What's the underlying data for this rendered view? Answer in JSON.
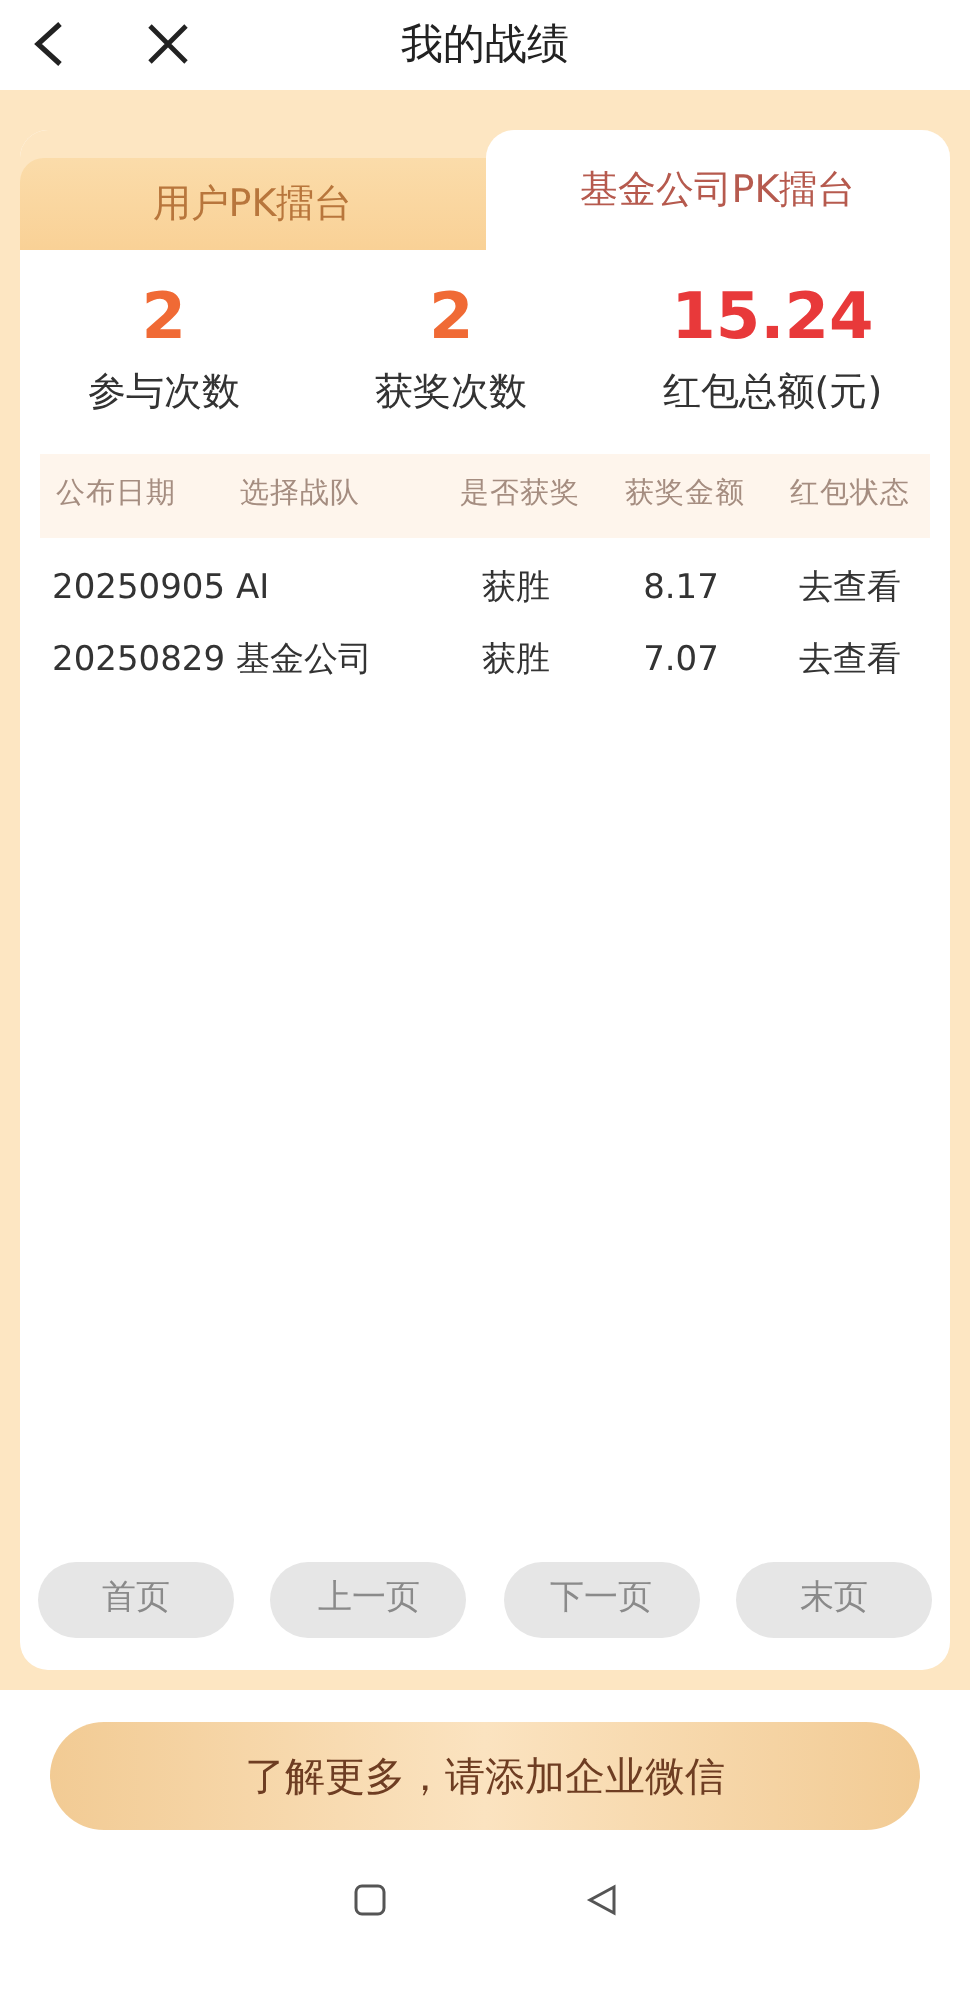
{
  "header": {
    "title": "我的战绩"
  },
  "tabs": [
    {
      "label": "用户PK擂台",
      "selected": false
    },
    {
      "label": "基金公司PK擂台",
      "selected": true
    }
  ],
  "stats": [
    {
      "value": "2",
      "label": "参与次数",
      "kind": "count"
    },
    {
      "value": "2",
      "label": "获奖次数",
      "kind": "count"
    },
    {
      "value": "15.24",
      "label": "红包总额(元)",
      "kind": "money"
    }
  ],
  "table": {
    "columns": [
      "公布日期",
      "选择战队",
      "是否获奖",
      "获奖金额",
      "红包状态"
    ],
    "rows": [
      [
        "20250905",
        "AI",
        "获胜",
        "8.17",
        "去查看"
      ],
      [
        "20250829",
        "基金公司",
        "获胜",
        "7.07",
        "去查看"
      ]
    ]
  },
  "pager": [
    {
      "label": "首页",
      "disabled": true
    },
    {
      "label": "上一页",
      "disabled": true
    },
    {
      "label": "下一页",
      "disabled": true
    },
    {
      "label": "末页",
      "disabled": true
    }
  ],
  "cta_button": "了解更多，请添加企业微信"
}
